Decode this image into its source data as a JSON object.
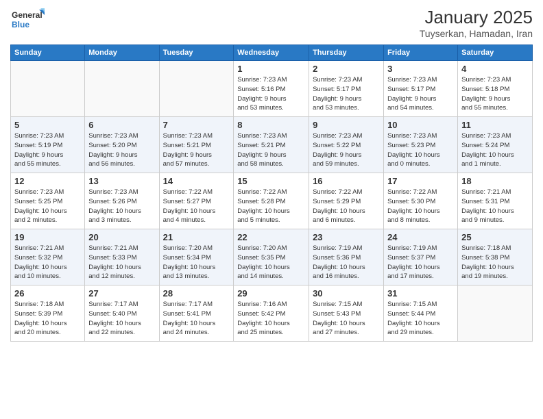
{
  "header": {
    "logo_line1": "General",
    "logo_line2": "Blue",
    "month": "January 2025",
    "location": "Tuyserkan, Hamadan, Iran"
  },
  "days_of_week": [
    "Sunday",
    "Monday",
    "Tuesday",
    "Wednesday",
    "Thursday",
    "Friday",
    "Saturday"
  ],
  "weeks": [
    [
      {
        "day": "",
        "detail": ""
      },
      {
        "day": "",
        "detail": ""
      },
      {
        "day": "",
        "detail": ""
      },
      {
        "day": "1",
        "detail": "Sunrise: 7:23 AM\nSunset: 5:16 PM\nDaylight: 9 hours\nand 53 minutes."
      },
      {
        "day": "2",
        "detail": "Sunrise: 7:23 AM\nSunset: 5:17 PM\nDaylight: 9 hours\nand 53 minutes."
      },
      {
        "day": "3",
        "detail": "Sunrise: 7:23 AM\nSunset: 5:17 PM\nDaylight: 9 hours\nand 54 minutes."
      },
      {
        "day": "4",
        "detail": "Sunrise: 7:23 AM\nSunset: 5:18 PM\nDaylight: 9 hours\nand 55 minutes."
      }
    ],
    [
      {
        "day": "5",
        "detail": "Sunrise: 7:23 AM\nSunset: 5:19 PM\nDaylight: 9 hours\nand 55 minutes."
      },
      {
        "day": "6",
        "detail": "Sunrise: 7:23 AM\nSunset: 5:20 PM\nDaylight: 9 hours\nand 56 minutes."
      },
      {
        "day": "7",
        "detail": "Sunrise: 7:23 AM\nSunset: 5:21 PM\nDaylight: 9 hours\nand 57 minutes."
      },
      {
        "day": "8",
        "detail": "Sunrise: 7:23 AM\nSunset: 5:21 PM\nDaylight: 9 hours\nand 58 minutes."
      },
      {
        "day": "9",
        "detail": "Sunrise: 7:23 AM\nSunset: 5:22 PM\nDaylight: 9 hours\nand 59 minutes."
      },
      {
        "day": "10",
        "detail": "Sunrise: 7:23 AM\nSunset: 5:23 PM\nDaylight: 10 hours\nand 0 minutes."
      },
      {
        "day": "11",
        "detail": "Sunrise: 7:23 AM\nSunset: 5:24 PM\nDaylight: 10 hours\nand 1 minute."
      }
    ],
    [
      {
        "day": "12",
        "detail": "Sunrise: 7:23 AM\nSunset: 5:25 PM\nDaylight: 10 hours\nand 2 minutes."
      },
      {
        "day": "13",
        "detail": "Sunrise: 7:23 AM\nSunset: 5:26 PM\nDaylight: 10 hours\nand 3 minutes."
      },
      {
        "day": "14",
        "detail": "Sunrise: 7:22 AM\nSunset: 5:27 PM\nDaylight: 10 hours\nand 4 minutes."
      },
      {
        "day": "15",
        "detail": "Sunrise: 7:22 AM\nSunset: 5:28 PM\nDaylight: 10 hours\nand 5 minutes."
      },
      {
        "day": "16",
        "detail": "Sunrise: 7:22 AM\nSunset: 5:29 PM\nDaylight: 10 hours\nand 6 minutes."
      },
      {
        "day": "17",
        "detail": "Sunrise: 7:22 AM\nSunset: 5:30 PM\nDaylight: 10 hours\nand 8 minutes."
      },
      {
        "day": "18",
        "detail": "Sunrise: 7:21 AM\nSunset: 5:31 PM\nDaylight: 10 hours\nand 9 minutes."
      }
    ],
    [
      {
        "day": "19",
        "detail": "Sunrise: 7:21 AM\nSunset: 5:32 PM\nDaylight: 10 hours\nand 10 minutes."
      },
      {
        "day": "20",
        "detail": "Sunrise: 7:21 AM\nSunset: 5:33 PM\nDaylight: 10 hours\nand 12 minutes."
      },
      {
        "day": "21",
        "detail": "Sunrise: 7:20 AM\nSunset: 5:34 PM\nDaylight: 10 hours\nand 13 minutes."
      },
      {
        "day": "22",
        "detail": "Sunrise: 7:20 AM\nSunset: 5:35 PM\nDaylight: 10 hours\nand 14 minutes."
      },
      {
        "day": "23",
        "detail": "Sunrise: 7:19 AM\nSunset: 5:36 PM\nDaylight: 10 hours\nand 16 minutes."
      },
      {
        "day": "24",
        "detail": "Sunrise: 7:19 AM\nSunset: 5:37 PM\nDaylight: 10 hours\nand 17 minutes."
      },
      {
        "day": "25",
        "detail": "Sunrise: 7:18 AM\nSunset: 5:38 PM\nDaylight: 10 hours\nand 19 minutes."
      }
    ],
    [
      {
        "day": "26",
        "detail": "Sunrise: 7:18 AM\nSunset: 5:39 PM\nDaylight: 10 hours\nand 20 minutes."
      },
      {
        "day": "27",
        "detail": "Sunrise: 7:17 AM\nSunset: 5:40 PM\nDaylight: 10 hours\nand 22 minutes."
      },
      {
        "day": "28",
        "detail": "Sunrise: 7:17 AM\nSunset: 5:41 PM\nDaylight: 10 hours\nand 24 minutes."
      },
      {
        "day": "29",
        "detail": "Sunrise: 7:16 AM\nSunset: 5:42 PM\nDaylight: 10 hours\nand 25 minutes."
      },
      {
        "day": "30",
        "detail": "Sunrise: 7:15 AM\nSunset: 5:43 PM\nDaylight: 10 hours\nand 27 minutes."
      },
      {
        "day": "31",
        "detail": "Sunrise: 7:15 AM\nSunset: 5:44 PM\nDaylight: 10 hours\nand 29 minutes."
      },
      {
        "day": "",
        "detail": ""
      }
    ]
  ]
}
